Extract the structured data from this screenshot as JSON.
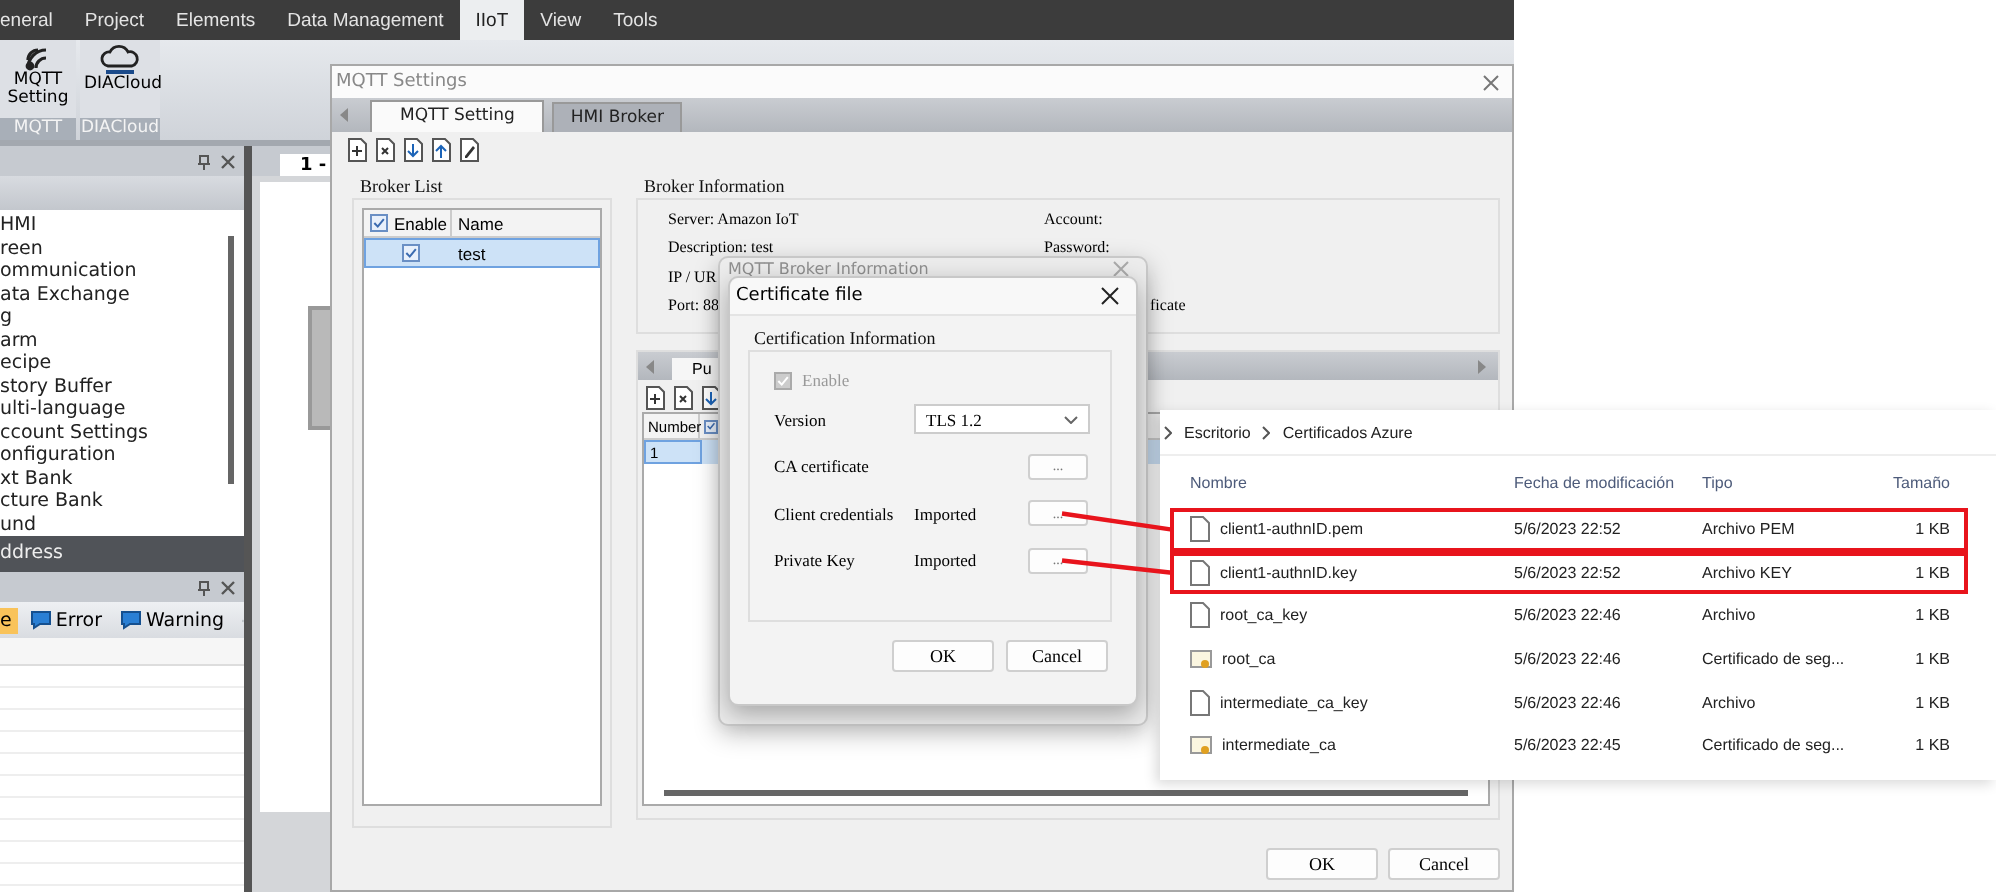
{
  "menu_bar": {
    "items": [
      {
        "label": "eneral",
        "selected": false
      },
      {
        "label": "Project",
        "selected": false
      },
      {
        "label": "Elements",
        "selected": false
      },
      {
        "label": "Data Management",
        "selected": false
      },
      {
        "label": "IIoT",
        "selected": true
      },
      {
        "label": "View",
        "selected": false
      },
      {
        "label": "Tools",
        "selected": false
      }
    ]
  },
  "ribbon": {
    "groups": [
      {
        "label": "MQTT",
        "buttons": [
          {
            "kind": "mqtt",
            "label": "MQTT Setting"
          }
        ]
      },
      {
        "label": "DIACloud",
        "buttons": [
          {
            "kind": "cloud",
            "label": "DIACloud"
          }
        ]
      }
    ]
  },
  "project_panel": {
    "items": [
      "HMI",
      "reen",
      "ommunication",
      "ata Exchange",
      "g",
      "arm",
      "ecipe",
      "story Buffer",
      "ulti-language",
      "ccount Settings",
      "onfiguration",
      "xt Bank",
      "cture Bank",
      "und"
    ]
  },
  "address_bar": {
    "label": "ddress"
  },
  "output_panel": {
    "filters": [
      {
        "kind": "message",
        "label": "e",
        "selected": true
      },
      {
        "kind": "error",
        "label": "Error",
        "selected": false
      },
      {
        "kind": "warning",
        "label": "Warning",
        "selected": false
      }
    ]
  },
  "document": {
    "tab": "1 -"
  },
  "mqtt_settings": {
    "title": "MQTT Settings",
    "tabs": [
      {
        "label": "MQTT Setting",
        "selected": true
      },
      {
        "label": "HMI Broker",
        "selected": false
      }
    ],
    "broker_list": {
      "title": "Broker List",
      "all_enabled": true,
      "columns": [
        "Enable",
        "Name"
      ],
      "rows": [
        {
          "enabled": true,
          "name": "test",
          "selected": true
        }
      ]
    },
    "broker_info": {
      "title": "Broker Information",
      "left": [
        "Server: Amazon IoT",
        "Description: test",
        "IP / UR",
        "Port: 88"
      ],
      "right": [
        "Account:",
        "Password:",
        "ficate"
      ]
    },
    "topics": {
      "tabs": [
        {
          "label": "Pu",
          "selected": true
        }
      ],
      "columns": [
        "Number"
      ],
      "all_enabled": true,
      "rows": [
        {
          "number": "1",
          "selected": true
        }
      ]
    },
    "buttons": [
      "OK",
      "Cancel"
    ]
  },
  "broker_dialog": {
    "title": "MQTT Broker Information"
  },
  "certificate_dialog": {
    "title": "Certificate file",
    "group": "Certification Information",
    "enable": {
      "label": "Enable",
      "checked": true,
      "disabled": true
    },
    "fields": [
      {
        "kind": "select",
        "label": "Version",
        "value": "TLS 1.2"
      },
      {
        "kind": "file",
        "label": "CA certificate",
        "button": "..."
      },
      {
        "kind": "file",
        "label": "Client credentials",
        "status": "Imported",
        "button": "..."
      },
      {
        "kind": "file",
        "label": "Private Key",
        "status": "Imported",
        "button": "..."
      }
    ],
    "buttons": [
      "OK",
      "Cancel"
    ]
  },
  "file_explorer": {
    "breadcrumb": [
      "Escritorio",
      "Certificados Azure"
    ],
    "columns": [
      "Nombre",
      "Fecha de modificación",
      "Tipo",
      "Tamaño"
    ],
    "rows": [
      {
        "kind": "file",
        "name": "client1-authnID.pem",
        "modified": "5/6/2023 22:52",
        "type": "Archivo PEM",
        "size": "1 KB",
        "highlighted": true
      },
      {
        "kind": "file",
        "name": "client1-authnID.key",
        "modified": "5/6/2023 22:52",
        "type": "Archivo KEY",
        "size": "1 KB",
        "highlighted": true
      },
      {
        "kind": "file",
        "name": "root_ca_key",
        "modified": "5/6/2023 22:46",
        "type": "Archivo",
        "size": "1 KB",
        "highlighted": false
      },
      {
        "kind": "certificate",
        "name": "root_ca",
        "modified": "5/6/2023 22:46",
        "type": "Certificado de seg...",
        "size": "1 KB",
        "highlighted": false
      },
      {
        "kind": "file",
        "name": "intermediate_ca_key",
        "modified": "5/6/2023 22:46",
        "type": "Archivo",
        "size": "1 KB",
        "highlighted": false
      },
      {
        "kind": "certificate",
        "name": "intermediate_ca",
        "modified": "5/6/2023 22:45",
        "type": "Certificado de seg...",
        "size": "1 KB",
        "highlighted": false
      }
    ]
  }
}
